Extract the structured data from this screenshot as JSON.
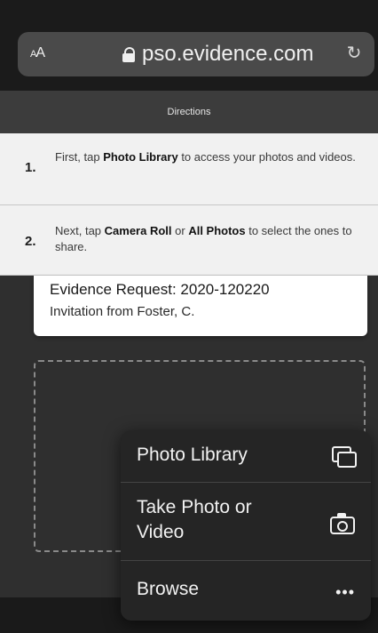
{
  "browser": {
    "text_size_label_small": "A",
    "text_size_label_large": "A",
    "url": "pso.evidence.com",
    "lock_icon": "lock-icon",
    "reload_icon": "reload-icon"
  },
  "directions": {
    "title": "Directions",
    "steps": [
      {
        "number": "1.",
        "text_before": "First, tap ",
        "bold1": "Photo Library",
        "text_after": " to access your photos and videos."
      },
      {
        "number": "2.",
        "text_before": "Next, tap ",
        "bold1": "Camera Roll",
        "text_mid": " or ",
        "bold2": "All Photos",
        "text_after": " to select the ones to share."
      }
    ]
  },
  "evidence": {
    "title": "Evidence Request: 2020-120220",
    "subtitle": "Invitation from Foster, C."
  },
  "menu": {
    "items": [
      {
        "label": "Photo Library",
        "icon": "photo-library-icon"
      },
      {
        "label": "Take Photo or Video",
        "icon": "camera-icon"
      },
      {
        "label": "Browse",
        "icon": "more-icon"
      }
    ]
  }
}
